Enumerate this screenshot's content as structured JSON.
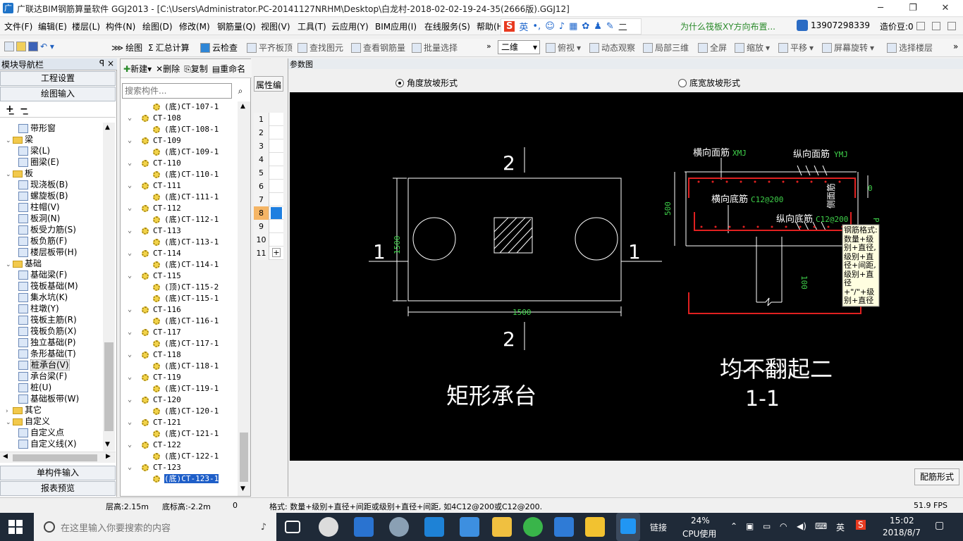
{
  "window": {
    "title": "广联达BIM钢筋算量软件 GGJ2013 - [C:\\Users\\Administrator.PC-20141127NRHM\\Desktop\\白龙村-2018-02-02-19-24-35(2666版).GGJ12]",
    "min": "─",
    "max": "❐",
    "close": "✕"
  },
  "menu": [
    "文件(F)",
    "编辑(E)",
    "楼层(L)",
    "构件(N)",
    "绘图(D)",
    "修改(M)",
    "钢筋量(Q)",
    "视图(V)",
    "工具(T)",
    "云应用(Y)",
    "BIM应用(I)",
    "在线服务(S)",
    "帮助(H"
  ],
  "ime": {
    "logo": "S",
    "lang": "英",
    "extra": "二"
  },
  "promo": "为什么筏板XY方向布置...",
  "phone": "13907298339",
  "cost_bean": "造价豆:0",
  "toolbar": {
    "draw": "绘图",
    "sum": "汇总计算",
    "cloud_check": "云检查",
    "flat_top": "平齐板顶",
    "find": "查找图元",
    "view_rebar": "查看钢筋量",
    "batch_select": "批量选择",
    "view_mode": "二维",
    "top_view": "俯视",
    "dynamic": "动态观察",
    "local3d": "局部三维",
    "full": "全屏",
    "zoom": "缩放",
    "pan": "平移",
    "rotate": "屏幕旋转",
    "select_floor": "选择楼层"
  },
  "nav": {
    "title": "模块导航栏",
    "pin": "ꟼ ×",
    "project_settings": "工程设置",
    "draw_input": "绘图输入",
    "single_input": "单构件输入",
    "report": "报表预览",
    "tree": [
      {
        "label": "带形窗",
        "level": 2,
        "type": "item"
      },
      {
        "label": "梁",
        "level": 1,
        "type": "folder",
        "exp": "⌄"
      },
      {
        "label": "梁(L)",
        "level": 2,
        "type": "item"
      },
      {
        "label": "圈梁(E)",
        "level": 2,
        "type": "item"
      },
      {
        "label": "板",
        "level": 1,
        "type": "folder",
        "exp": "⌄"
      },
      {
        "label": "现浇板(B)",
        "level": 2,
        "type": "item"
      },
      {
        "label": "螺旋板(B)",
        "level": 2,
        "type": "item"
      },
      {
        "label": "柱帽(V)",
        "level": 2,
        "type": "item"
      },
      {
        "label": "板洞(N)",
        "level": 2,
        "type": "item"
      },
      {
        "label": "板受力筋(S)",
        "level": 2,
        "type": "item"
      },
      {
        "label": "板负筋(F)",
        "level": 2,
        "type": "item"
      },
      {
        "label": "楼层板带(H)",
        "level": 2,
        "type": "item"
      },
      {
        "label": "基础",
        "level": 1,
        "type": "folder",
        "exp": "⌄"
      },
      {
        "label": "基础梁(F)",
        "level": 2,
        "type": "item"
      },
      {
        "label": "筏板基础(M)",
        "level": 2,
        "type": "item"
      },
      {
        "label": "集水坑(K)",
        "level": 2,
        "type": "item"
      },
      {
        "label": "柱墩(Y)",
        "level": 2,
        "type": "item"
      },
      {
        "label": "筏板主筋(R)",
        "level": 2,
        "type": "item"
      },
      {
        "label": "筏板负筋(X)",
        "level": 2,
        "type": "item"
      },
      {
        "label": "独立基础(P)",
        "level": 2,
        "type": "item"
      },
      {
        "label": "条形基础(T)",
        "level": 2,
        "type": "item"
      },
      {
        "label": "桩承台(V)",
        "level": 2,
        "type": "item",
        "selected": true
      },
      {
        "label": "承台梁(F)",
        "level": 2,
        "type": "item"
      },
      {
        "label": "桩(U)",
        "level": 2,
        "type": "item"
      },
      {
        "label": "基础板带(W)",
        "level": 2,
        "type": "item"
      },
      {
        "label": "其它",
        "level": 1,
        "type": "folder",
        "exp": "›"
      },
      {
        "label": "自定义",
        "level": 1,
        "type": "folder",
        "exp": "⌄"
      },
      {
        "label": "自定义点",
        "level": 2,
        "type": "item"
      },
      {
        "label": "自定义线(X)",
        "level": 2,
        "type": "item"
      }
    ]
  },
  "list": {
    "new": "新建",
    "delete": "删除",
    "copy": "复制",
    "rename": "重命名",
    "search_placeholder": "搜索构件...",
    "rows": [
      {
        "label": "(底)CT-107-1",
        "child": true
      },
      {
        "label": "CT-108",
        "child": false
      },
      {
        "label": "(底)CT-108-1",
        "child": true
      },
      {
        "label": "CT-109",
        "child": false
      },
      {
        "label": "(底)CT-109-1",
        "child": true
      },
      {
        "label": "CT-110",
        "child": false
      },
      {
        "label": "(底)CT-110-1",
        "child": true
      },
      {
        "label": "CT-111",
        "child": false
      },
      {
        "label": "(底)CT-111-1",
        "child": true
      },
      {
        "label": "CT-112",
        "child": false
      },
      {
        "label": "(底)CT-112-1",
        "child": true
      },
      {
        "label": "CT-113",
        "child": false
      },
      {
        "label": "(底)CT-113-1",
        "child": true
      },
      {
        "label": "CT-114",
        "child": false
      },
      {
        "label": "(底)CT-114-1",
        "child": true
      },
      {
        "label": "CT-115",
        "child": false
      },
      {
        "label": "(顶)CT-115-2",
        "child": true
      },
      {
        "label": "(底)CT-115-1",
        "child": true
      },
      {
        "label": "CT-116",
        "child": false
      },
      {
        "label": "(底)CT-116-1",
        "child": true
      },
      {
        "label": "CT-117",
        "child": false
      },
      {
        "label": "(底)CT-117-1",
        "child": true
      },
      {
        "label": "CT-118",
        "child": false
      },
      {
        "label": "(底)CT-118-1",
        "child": true
      },
      {
        "label": "CT-119",
        "child": false
      },
      {
        "label": "(底)CT-119-1",
        "child": true
      },
      {
        "label": "CT-120",
        "child": false
      },
      {
        "label": "(底)CT-120-1",
        "child": true
      },
      {
        "label": "CT-121",
        "child": false
      },
      {
        "label": "(底)CT-121-1",
        "child": true
      },
      {
        "label": "CT-122",
        "child": false
      },
      {
        "label": "(底)CT-122-1",
        "child": true
      },
      {
        "label": "CT-123",
        "child": false
      },
      {
        "label": "(底)CT-123-1",
        "child": true,
        "selected": true
      }
    ]
  },
  "props": {
    "title": "属性编",
    "rows": [
      "1",
      "2",
      "3",
      "4",
      "5",
      "6",
      "7",
      "8",
      "9",
      "10",
      "11"
    ],
    "add": "+"
  },
  "param": {
    "title": "参数图",
    "radio_angle": "角度放坡形式",
    "radio_width": "底宽放坡形式",
    "rebar_form_btn": "配筋形式",
    "drawing": {
      "sec_top": "2",
      "sec_bottom": "2",
      "sec_left": "1",
      "sec_right": "1",
      "dim_h": "1500",
      "dim_w": "1500",
      "plan_title": "矩形承台",
      "lbl_hmj": "横向面筋",
      "lbl_hmj_code": "XMJ",
      "lbl_zmj": "纵向面筋",
      "lbl_zmj_code": "YMJ",
      "lbl_hdj": "横向底筋",
      "lbl_hdj_code": "C12@200",
      "lbl_zdj": "纵向底筋",
      "lbl_zdj_code": "C12@200",
      "lbl_cmj": "侧面筋",
      "dim_500": "500",
      "dim_0": "0",
      "dim_100": "100",
      "dim_p": "P",
      "note": "均不翻起二",
      "section_title": "1-1",
      "tooltip": "钢筋格式:数量+级别+直径,级别+直径+间距,级别+直径+\"/\"+级别+直径+间距。"
    }
  },
  "status": {
    "floor_h": "层高:2.15m",
    "bottom_h": "底标高:-2.2m",
    "zero": "0",
    "format": "格式: 数量+级别+直径+间距或级别+直径+间距, 如4C12@200或C12@200.",
    "fps": "51.9 FPS"
  },
  "taskbar": {
    "search": "在这里输入你要搜索的内容",
    "link": "链接",
    "cpu_pct": "24%",
    "cpu": "CPU使用",
    "time": "15:02",
    "date": "2018/8/7",
    "lang": "英"
  }
}
